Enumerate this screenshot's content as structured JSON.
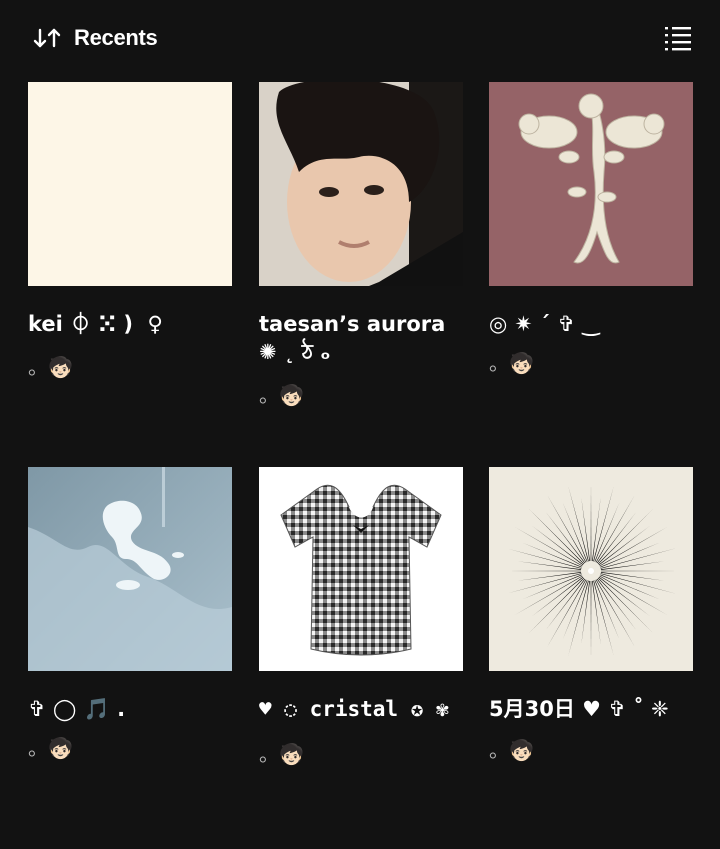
{
  "header": {
    "sort_label": "Recents",
    "sort_icon": "sort-arrows-icon",
    "view_icon": "list-view-icon"
  },
  "colors": {
    "background": "#121212",
    "text_primary": "#ffffff",
    "text_secondary": "#b3b3b3"
  },
  "playlists": [
    {
      "title": "kei ⏀ ⵘ )  ♀",
      "subtitle": "。🧒🏻",
      "cover": "cream-blank"
    },
    {
      "title": "taesan’s aurora ✺ ˛ ঠ ₒ",
      "subtitle": "。🧒🏻",
      "cover": "selfie-portrait"
    },
    {
      "title": "◎ ✷ ˊ ✞ ‿",
      "subtitle": "。🧒🏻",
      "cover": "cherub-hook"
    },
    {
      "title": "✞ ◯ 🎵 .",
      "subtitle": "。🧒🏻",
      "cover": "water-reflection"
    },
    {
      "title": "♥ ◌ cristal ✪ ✾",
      "subtitle": "。🧒🏻",
      "cover": "gingham-top"
    },
    {
      "title": "5月30日 ♥ ✞ ˚ ❈",
      "subtitle": "。🧒🏻",
      "cover": "starburst"
    }
  ]
}
